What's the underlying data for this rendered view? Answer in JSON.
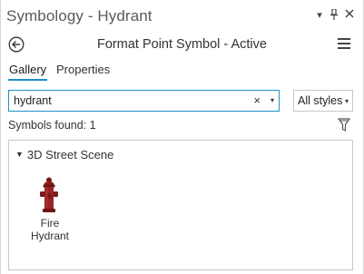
{
  "titlebar": {
    "title": "Symbology - Hydrant",
    "icons": [
      "dropdown-arrow-icon",
      "pin-icon",
      "close-icon"
    ]
  },
  "header": {
    "title": "Format Point Symbol - Active",
    "back_icon": "back-arrow-icon",
    "menu_icon": "hamburger-menu-icon"
  },
  "tabs": [
    {
      "label": "Gallery",
      "active": true
    },
    {
      "label": "Properties",
      "active": false
    }
  ],
  "search": {
    "value": "hydrant",
    "clear_glyph": "×",
    "dropdown_glyph": "▾"
  },
  "styles_dropdown": {
    "selected": "All styles",
    "dropdown_glyph": "▾"
  },
  "results": {
    "count_text": "Symbols found: 1"
  },
  "gallery": {
    "groups": [
      {
        "name": "3D Street Scene",
        "expanded": true,
        "items": [
          {
            "line1": "Fire",
            "line2": "Hydrant",
            "icon": "fire-hydrant-icon"
          }
        ]
      }
    ]
  },
  "colors": {
    "accent": "#1e8ecd",
    "hydrant": "#8c1d1d"
  }
}
